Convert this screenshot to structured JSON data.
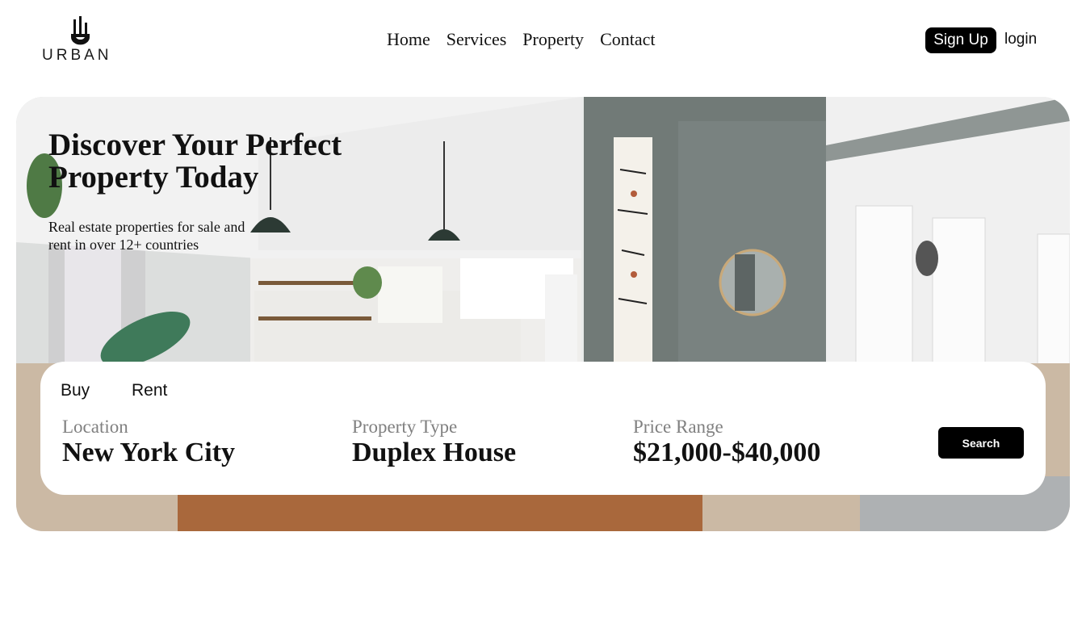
{
  "brand": {
    "name": "URBAN",
    "logo_icon": "building-logo-icon"
  },
  "nav": {
    "home": "Home",
    "services": "Services",
    "property": "Property",
    "contact": "Contact"
  },
  "auth": {
    "signup_label": "Sign Up",
    "login_label": "login"
  },
  "hero": {
    "title": "Discover Your Perfect Property Today",
    "subtitle": "Real estate properties for sale and rent in over 12+ countries"
  },
  "search": {
    "tabs": {
      "buy": "Buy",
      "rent": "Rent"
    },
    "location": {
      "label": "Location",
      "value": "New York City"
    },
    "property_type": {
      "label": "Property Type",
      "value": "Duplex House"
    },
    "price_range": {
      "label": "Price Range",
      "value": "$21,000-$40,000"
    },
    "button_label": "Search"
  },
  "colors": {
    "primary_button": "#000000",
    "label_gray": "#808080",
    "background": "#ffffff"
  }
}
